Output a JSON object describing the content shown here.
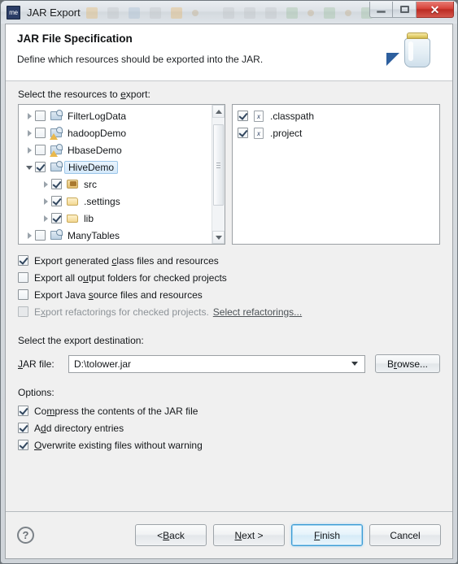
{
  "window": {
    "title": "JAR Export",
    "app_icon": "me",
    "minimize_label": "Minimize",
    "maximize_label": "Maximize",
    "close_label": "Close"
  },
  "banner": {
    "title": "JAR File Specification",
    "subtitle": "Define which resources should be exported into the JAR.",
    "art_icon": "jar-with-arrow-icon"
  },
  "resources": {
    "label_pre": "Select the resources to ",
    "label_mnemonic": "e",
    "label_post": "xport:",
    "left_tree": [
      {
        "label": "FilterLogData",
        "icon": "java-project-icon",
        "checked": false,
        "expanded": false,
        "level": 0,
        "warning": false,
        "selected": false
      },
      {
        "label": "hadoopDemo",
        "icon": "java-project-icon",
        "checked": false,
        "expanded": false,
        "level": 0,
        "warning": true,
        "selected": false
      },
      {
        "label": "HbaseDemo",
        "icon": "java-project-icon",
        "checked": false,
        "expanded": false,
        "level": 0,
        "warning": true,
        "selected": false
      },
      {
        "label": "HiveDemo",
        "icon": "java-project-icon",
        "checked": true,
        "expanded": true,
        "level": 0,
        "warning": false,
        "selected": true
      },
      {
        "label": "src",
        "icon": "source-folder-icon",
        "checked": true,
        "expanded": false,
        "level": 1,
        "warning": false,
        "selected": false
      },
      {
        "label": ".settings",
        "icon": "folder-icon",
        "checked": true,
        "expanded": false,
        "level": 1,
        "warning": false,
        "selected": false
      },
      {
        "label": "lib",
        "icon": "folder-icon",
        "checked": true,
        "expanded": false,
        "level": 1,
        "warning": false,
        "selected": false
      },
      {
        "label": "ManyTables",
        "icon": "java-project-icon",
        "checked": false,
        "expanded": false,
        "level": 0,
        "warning": false,
        "selected": false
      }
    ],
    "right_list": [
      {
        "label": ".classpath",
        "icon": "xml-file-icon",
        "glyph": "x",
        "checked": true
      },
      {
        "label": ".project",
        "icon": "xml-file-icon",
        "glyph": "x",
        "checked": true
      }
    ]
  },
  "export_options": [
    {
      "pre": "Export generated ",
      "mnemonic": "c",
      "post": "lass files and resources",
      "checked": true,
      "disabled": false,
      "link": ""
    },
    {
      "pre": "Export all o",
      "mnemonic": "u",
      "post": "tput folders for checked projects",
      "checked": false,
      "disabled": false,
      "link": ""
    },
    {
      "pre": "Export Java ",
      "mnemonic": "s",
      "post": "ource files and resources",
      "checked": false,
      "disabled": false,
      "link": ""
    },
    {
      "pre": "E",
      "mnemonic": "x",
      "post": "port refactorings for checked projects.",
      "checked": false,
      "disabled": true,
      "link": "Select refactorings..."
    }
  ],
  "destination": {
    "section_label": "Select the export destination:",
    "field_label_pre": "",
    "field_label_mnemonic": "J",
    "field_label_post": "AR file:",
    "value": "D:\\tolower.jar",
    "placeholder": "",
    "browse_pre": "B",
    "browse_mnemonic": "r",
    "browse_post": "owse..."
  },
  "options": {
    "section_label": "Options:",
    "items": [
      {
        "pre": "Co",
        "mnemonic": "m",
        "post": "press the contents of the JAR file",
        "checked": true
      },
      {
        "pre": "A",
        "mnemonic": "d",
        "post": "d directory entries",
        "checked": true
      },
      {
        "pre": "",
        "mnemonic": "O",
        "post": "verwrite existing files without warning",
        "checked": true
      }
    ]
  },
  "footer": {
    "help_glyph": "?",
    "buttons": [
      {
        "pre": "< ",
        "mnemonic": "B",
        "post": "ack",
        "focused": false
      },
      {
        "pre": "",
        "mnemonic": "N",
        "post": "ext >",
        "focused": false
      },
      {
        "pre": "",
        "mnemonic": "F",
        "post": "inish",
        "focused": true
      },
      {
        "pre": "Cancel",
        "mnemonic": "",
        "post": "",
        "focused": false
      }
    ]
  },
  "colors": {
    "accent_focus": "#3b9ad4",
    "close_button": "#d7433a",
    "selection": "#d4e9fb",
    "banner_bg": "#ffffff",
    "dialog_bg": "#f0f0f0"
  }
}
